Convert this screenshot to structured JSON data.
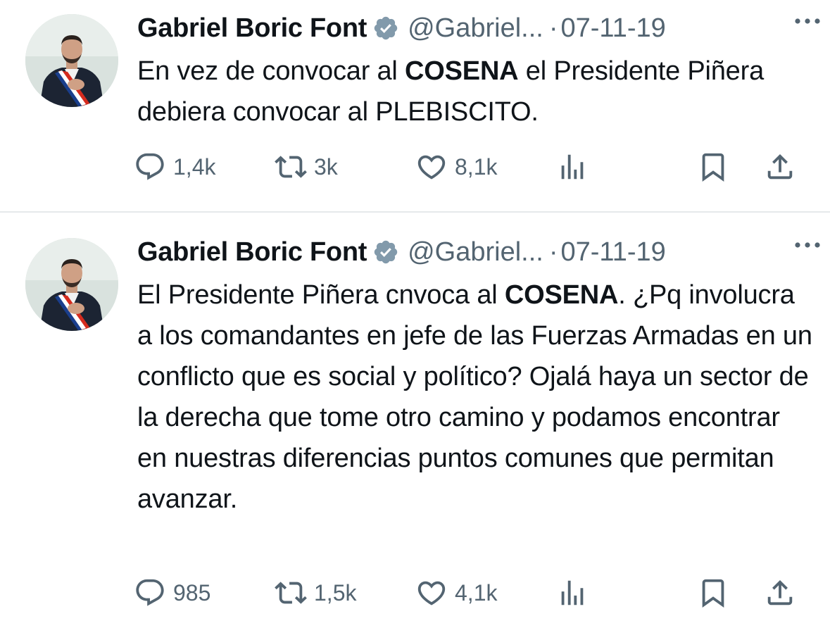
{
  "tweets": [
    {
      "author_name": "Gabriel Boric Font",
      "handle": "@Gabriel...",
      "separator": "·",
      "date": "07-11-19",
      "text_parts": {
        "p1": "En vez de convocar al ",
        "b1": "COSENA",
        "p2": " el Presidente Piñera debiera convocar al PLEBISCITO."
      },
      "replies": "1,4k",
      "retweets": "3k",
      "likes": "8,1k"
    },
    {
      "author_name": "Gabriel Boric Font",
      "handle": "@Gabriel...",
      "separator": "·",
      "date": "07-11-19",
      "text_parts": {
        "p1": "El Presidente Piñera cnvoca al ",
        "b1": "COSENA",
        "p2": ". ¿Pq involucra a los comandantes en jefe de las Fuerzas Armadas en un conflicto que es social y político? Ojalá haya un sector de la derecha que tome otro camino y podamos encontrar en nuestras diferencias puntos comunes que permitan avanzar."
      },
      "replies": "985",
      "retweets": "1,5k",
      "likes": "4,1k"
    }
  ],
  "colors": {
    "text": "#0f1419",
    "secondary": "#536471",
    "verified_badge": "#829aab",
    "divider": "#e6e9eb"
  },
  "icons": [
    "more-icon",
    "verified-badge-icon",
    "reply-icon",
    "retweet-icon",
    "like-icon",
    "views-icon",
    "bookmark-icon",
    "share-icon"
  ]
}
